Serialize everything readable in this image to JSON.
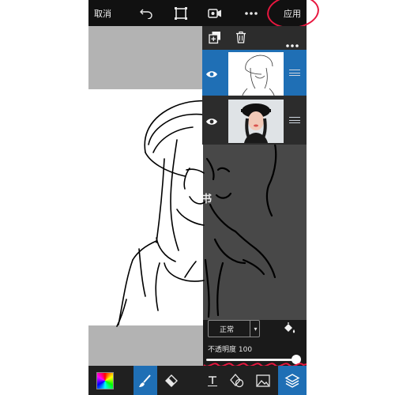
{
  "topbar": {
    "cancel_label": "取消",
    "apply_label": "应用",
    "icons": [
      "undo-icon",
      "crop-icon",
      "record-icon",
      "more-icon"
    ]
  },
  "canvas": {
    "watermark_text": "书"
  },
  "layers_panel": {
    "icons": [
      "add-layer-icon",
      "trash-icon",
      "more-icon"
    ],
    "layers": [
      {
        "name": "sketch-layer",
        "visible": true,
        "selected": true
      },
      {
        "name": "photo-layer",
        "visible": true,
        "selected": false
      }
    ]
  },
  "bottom_panel": {
    "blend_mode": "正常",
    "opacity_label": "不透明度 100",
    "opacity": 100
  },
  "toolbar": {
    "tools": [
      "color-picker",
      "brush",
      "eraser",
      "text",
      "shapes",
      "image",
      "layers"
    ],
    "active_tools": [
      "brush",
      "layers"
    ]
  },
  "colors": {
    "accent": "#1f6fb5",
    "annotation": "#e8173f",
    "bar": "#111111"
  }
}
